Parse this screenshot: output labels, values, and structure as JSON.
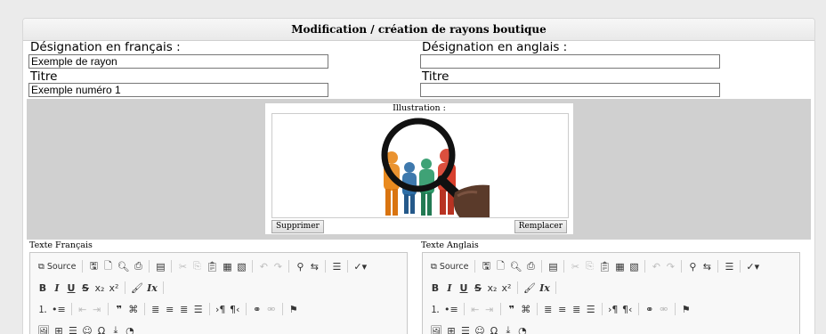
{
  "panel": {
    "title": "Modification / création de rayons boutique"
  },
  "fields": {
    "fr_label": "Désignation en français :",
    "fr_value": "Exemple de rayon",
    "en_label": "Désignation en anglais :",
    "en_value": "",
    "title_fr_label": "Titre",
    "title_fr_value": "Exemple numéro 1",
    "title_en_label": "Titre",
    "title_en_value": ""
  },
  "illustration": {
    "label": "Illustration :",
    "delete_button": "Supprimer",
    "replace_button": "Remplacer"
  },
  "editors": {
    "fr_label": "Texte Français",
    "en_label": "Texte Anglais",
    "source_label": "Source"
  },
  "colors": {
    "header_bg": "#ececec",
    "band_bg": "#d0d0d0"
  }
}
